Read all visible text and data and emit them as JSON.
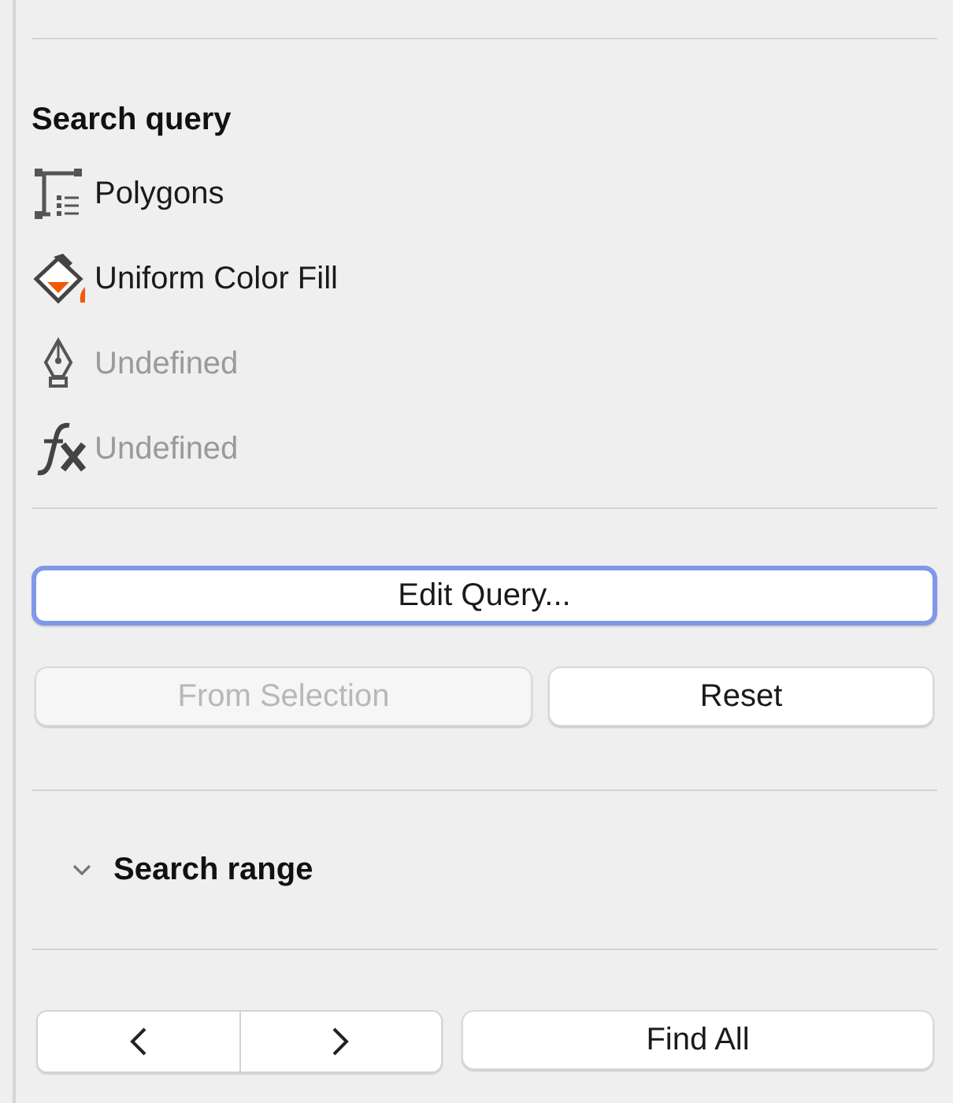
{
  "search_query": {
    "heading": "Search query",
    "items": [
      {
        "kind": "polygon",
        "label": "Polygons",
        "disabled": false
      },
      {
        "kind": "fill",
        "label": "Uniform Color Fill",
        "disabled": false
      },
      {
        "kind": "pen",
        "label": "Undefined",
        "disabled": true
      },
      {
        "kind": "function",
        "label": "Undefined",
        "disabled": true
      }
    ]
  },
  "edit_button": {
    "label": "Edit Query...",
    "focused": true
  },
  "query_buttons": [
    {
      "label": "From Selection",
      "disabled": true
    },
    {
      "label": "Reset",
      "disabled": false
    }
  ],
  "search_range": {
    "label": "Search range",
    "expanded": true
  },
  "find_all_button": {
    "label": "Find All"
  }
}
